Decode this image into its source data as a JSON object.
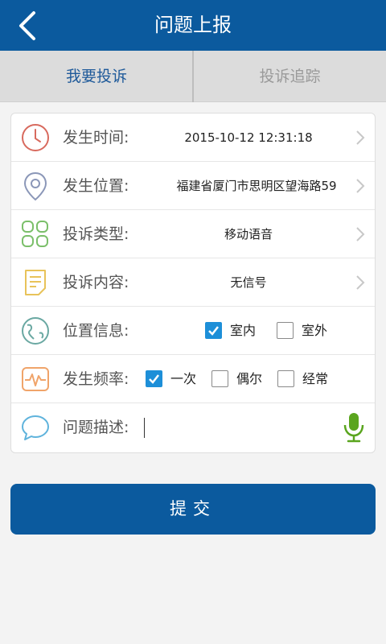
{
  "header": {
    "title": "问题上报",
    "back_icon": "back-arrow-icon"
  },
  "tabs": [
    {
      "label": "我要投诉",
      "active": true
    },
    {
      "label": "投诉追踪",
      "active": false
    }
  ],
  "form": {
    "time": {
      "label": "发生时间:",
      "value": "2015-10-12 12:31:18",
      "icon": "clock-icon"
    },
    "location": {
      "label": "发生位置:",
      "value": "福建省厦门市思明区望海路59",
      "icon": "map-pin-icon"
    },
    "type": {
      "label": "投诉类型:",
      "value": "移动语音",
      "icon": "grid-icon"
    },
    "content": {
      "label": "投诉内容:",
      "value": "无信号",
      "icon": "notepad-icon"
    },
    "position_info": {
      "label": "位置信息:",
      "icon": "globe-icon",
      "options": [
        {
          "label": "室内",
          "checked": true
        },
        {
          "label": "室外",
          "checked": false
        }
      ]
    },
    "frequency": {
      "label": "发生频率:",
      "icon": "pulse-icon",
      "options": [
        {
          "label": "一次",
          "checked": true
        },
        {
          "label": "偶尔",
          "checked": false
        },
        {
          "label": "经常",
          "checked": false
        }
      ]
    },
    "description": {
      "label": "问题描述:",
      "value": "",
      "icon": "chat-bubble-icon",
      "mic_icon": "microphone-icon"
    }
  },
  "submit": {
    "label": "提交"
  },
  "colors": {
    "primary": "#0b5a9e",
    "checkbox": "#1d8fd8",
    "mic": "#5aa51e"
  }
}
